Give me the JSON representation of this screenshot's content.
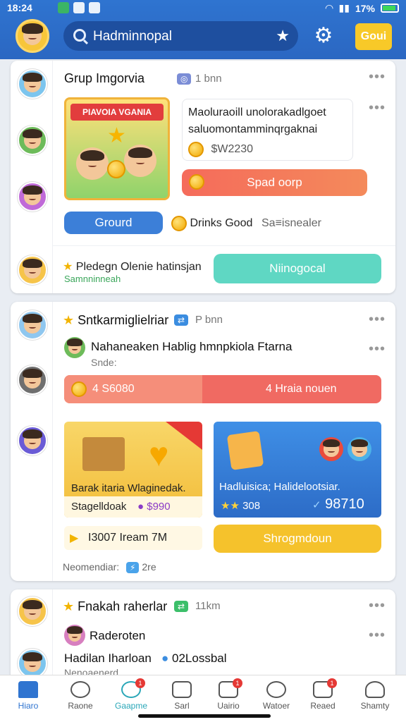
{
  "status": {
    "time": "18:24",
    "battery": "17%"
  },
  "header": {
    "search_text": "Hadminnopal",
    "action_label": "Goui"
  },
  "card1": {
    "title": "Grup Imgorvia",
    "time": "1 bnn",
    "banner_text": "PIAVOIA VGANIA",
    "promo_line1": "Maoluraoill unolorakadlgoet",
    "promo_line2": "saluomontamminqrgaknai",
    "promo_amount": "$W2230",
    "send_button": "Spad oorp",
    "group_button": "Grourd",
    "drinks_label": "Drinks Good",
    "secondary_label": "Sa≡isnealer",
    "footer_line1": "Pledegn Olenie hatinsjan",
    "footer_line2": "Samnninneah",
    "footer_button": "Niinogocal"
  },
  "card2": {
    "title": "Sntkarmiglielriar",
    "time": "P bnn",
    "sub_title": "Nahaneaken Hablig hmnpkiola Ftarna",
    "sub_sub": "Snde:",
    "bar_left": "4 S6080",
    "bar_right": "4 Hraia nouen",
    "tile1_title": "Barak itaria Wlaginedak.",
    "tile1_sub": "Stagelldoak",
    "tile1_price": "$990",
    "tile2_title": "Hadluisica; Halidelootsiar.",
    "tile2_rating": "308",
    "tile2_price": "98710",
    "bottom_left": "I3007 Iream 7M",
    "bottom_button": "Shrogmdoun",
    "footnote": "Neomendiar:",
    "footnote_badge": "2re"
  },
  "card3": {
    "title": "Fnakah raherlar",
    "time": "11km",
    "name": "Raderoten",
    "text": "Hadilan Iharloan",
    "text2": "02Lossbal",
    "text3": "Nenoaenerd"
  },
  "nav": [
    {
      "label": "Hiaro"
    },
    {
      "label": "Raone"
    },
    {
      "label": "Gaapme"
    },
    {
      "label": "Sarl"
    },
    {
      "label": "Uairio"
    },
    {
      "label": "Watoer"
    },
    {
      "label": "Reaed"
    },
    {
      "label": "Shamty"
    }
  ]
}
